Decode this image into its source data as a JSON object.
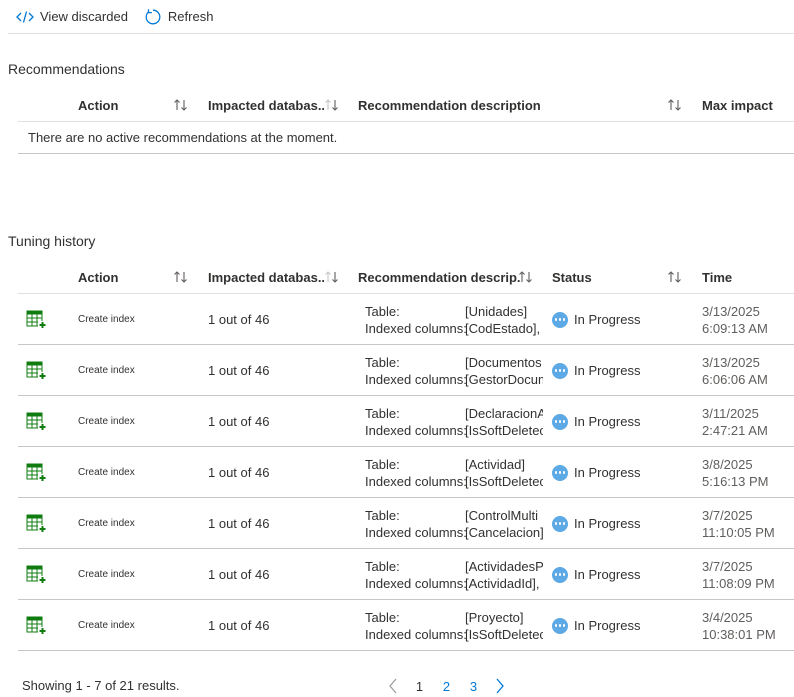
{
  "toolbar": {
    "view_discarded_label": "View discarded",
    "refresh_label": "Refresh",
    "view_discarded_icon": "code-icon",
    "refresh_icon": "refresh-icon"
  },
  "recommendations": {
    "title": "Recommendations",
    "columns": {
      "action": "Action",
      "impacted": "Impacted databas...",
      "description": "Recommendation description",
      "max_impact": "Max impact"
    },
    "empty_message": "There are no active recommendations at the moment."
  },
  "tuning_history": {
    "title": "Tuning history",
    "columns": {
      "action": "Action",
      "impacted": "Impacted databas...",
      "description": "Recommendation descrip...",
      "status": "Status",
      "time": "Time"
    },
    "rows": [
      {
        "action": "Create index",
        "impacted": "1 out of 46",
        "table_label": "Table:",
        "table_value": "[Unidades]",
        "columns_label": "Indexed columns:",
        "columns_value": "[CodEstado],",
        "status": "In Progress",
        "date": "3/13/2025",
        "time": "6:09:13 AM"
      },
      {
        "action": "Create index",
        "impacted": "1 out of 46",
        "table_label": "Table:",
        "table_value": "[Documentos",
        "columns_label": "Indexed columns:",
        "columns_value": "[GestorDocum",
        "status": "In Progress",
        "date": "3/13/2025",
        "time": "6:06:06 AM"
      },
      {
        "action": "Create index",
        "impacted": "1 out of 46",
        "table_label": "Table:",
        "table_value": "[DeclaracionA",
        "columns_label": "Indexed columns:",
        "columns_value": "[IsSoftDeletec",
        "status": "In Progress",
        "date": "3/11/2025",
        "time": "2:47:21 AM"
      },
      {
        "action": "Create index",
        "impacted": "1 out of 46",
        "table_label": "Table:",
        "table_value": "[Actividad]",
        "columns_label": "Indexed columns:",
        "columns_value": "[IsSoftDeletec",
        "status": "In Progress",
        "date": "3/8/2025",
        "time": "5:16:13 PM"
      },
      {
        "action": "Create index",
        "impacted": "1 out of 46",
        "table_label": "Table:",
        "table_value": "[ControlMulti",
        "columns_label": "Indexed columns:",
        "columns_value": "[Cancelacion]",
        "status": "In Progress",
        "date": "3/7/2025",
        "time": "11:10:05 PM"
      },
      {
        "action": "Create index",
        "impacted": "1 out of 46",
        "table_label": "Table:",
        "table_value": "[ActividadesP",
        "columns_label": "Indexed columns:",
        "columns_value": "[ActividadId],",
        "status": "In Progress",
        "date": "3/7/2025",
        "time": "11:08:09 PM"
      },
      {
        "action": "Create index",
        "impacted": "1 out of 46",
        "table_label": "Table:",
        "table_value": "[Proyecto]",
        "columns_label": "Indexed columns:",
        "columns_value": "[IsSoftDeletec",
        "status": "In Progress",
        "date": "3/4/2025",
        "time": "10:38:01 PM"
      }
    ]
  },
  "footer": {
    "summary": "Showing 1 - 7 of 21 results.",
    "pages": [
      "1",
      "2",
      "3"
    ],
    "current_page": "1"
  },
  "colors": {
    "accent": "#0078d4",
    "status_in_progress": "#5ca9e5",
    "index_icon_green": "#107c10"
  }
}
